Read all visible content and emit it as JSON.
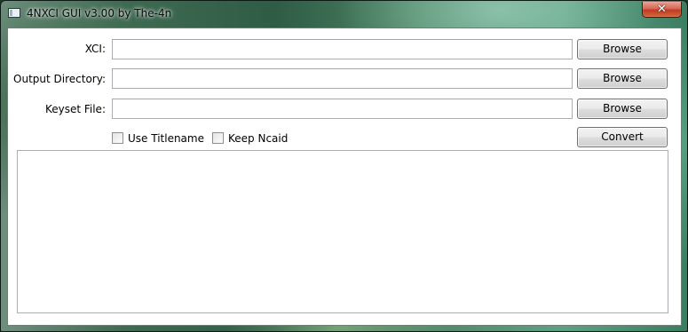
{
  "window": {
    "title": "4NXCI GUI v3.00 by The-4n",
    "close_symbol": "✕"
  },
  "form": {
    "xci": {
      "label": "XCI:",
      "value": "",
      "button": "Browse"
    },
    "output_directory": {
      "label": "Output Directory:",
      "value": "",
      "button": "Browse"
    },
    "keyset_file": {
      "label": "Keyset File:",
      "value": "",
      "button": "Browse"
    }
  },
  "options": {
    "use_titlename": {
      "label": "Use Titlename",
      "checked": false
    },
    "keep_ncaid": {
      "label": "Keep Ncaid",
      "checked": false
    }
  },
  "actions": {
    "convert": "Convert"
  },
  "log": {
    "text": ""
  },
  "icons": {
    "app": "app-window-icon",
    "close": "close-icon"
  },
  "colors": {
    "close_button": "#c13b22",
    "window_glass": "#3f6a52",
    "client_background": "#ffffff"
  }
}
